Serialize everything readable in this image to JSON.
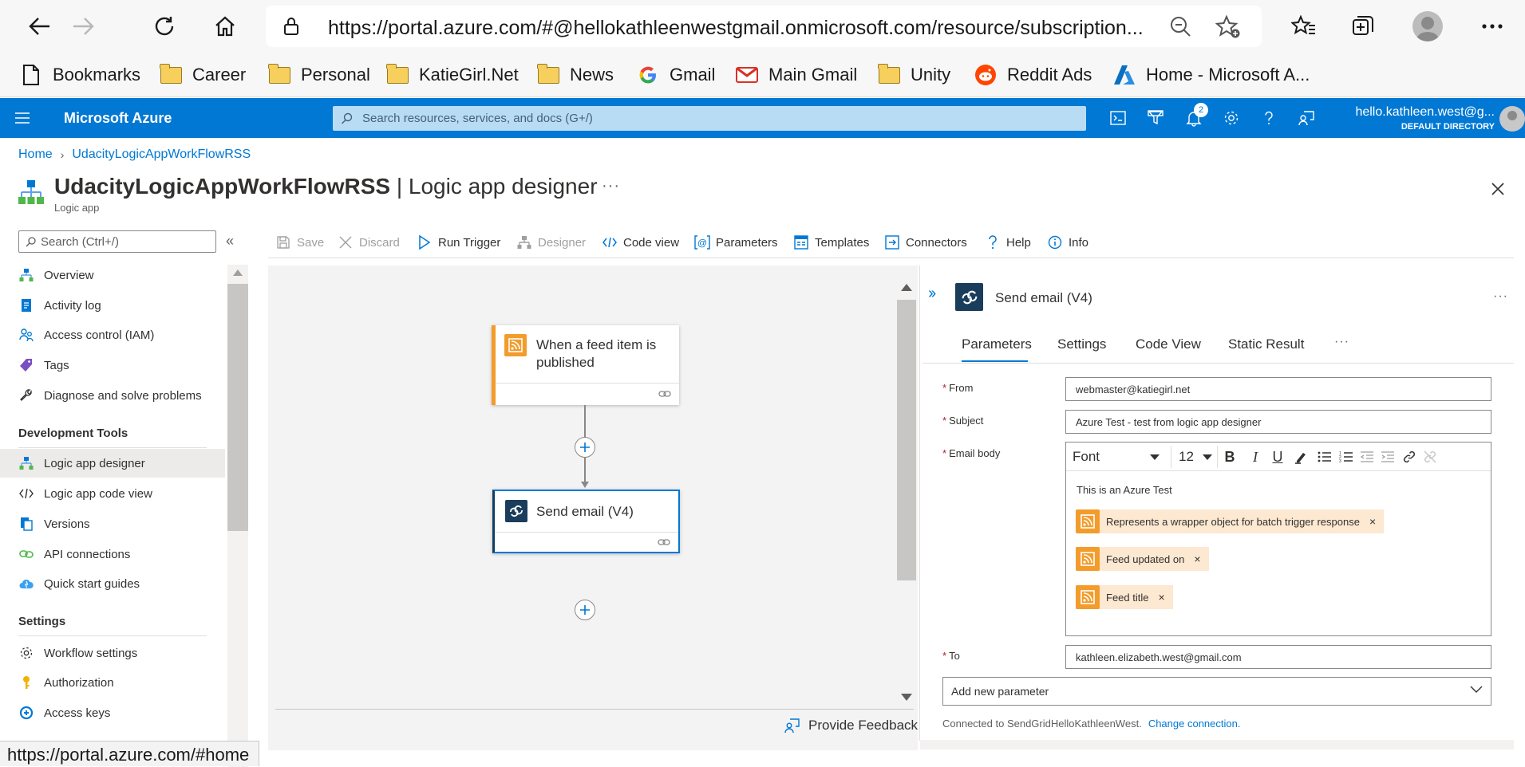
{
  "browser": {
    "url": "https://portal.azure.com/#@hellokathleenwestgmail.onmicrosoft.com/resource/subscription...",
    "bookmarks": [
      {
        "label": "Bookmarks",
        "icon": "page-icon"
      },
      {
        "label": "Career",
        "icon": "folder-icon"
      },
      {
        "label": "Personal",
        "icon": "folder-icon"
      },
      {
        "label": "KatieGirl.Net",
        "icon": "folder-icon"
      },
      {
        "label": "News",
        "icon": "folder-icon"
      },
      {
        "label": "Gmail",
        "icon": "google-icon"
      },
      {
        "label": "Main Gmail",
        "icon": "gmail-icon"
      },
      {
        "label": "Unity",
        "icon": "folder-icon"
      },
      {
        "label": "Reddit Ads",
        "icon": "reddit-icon"
      },
      {
        "label": "Home - Microsoft A...",
        "icon": "azure-icon"
      }
    ],
    "status_url": "https://portal.azure.com/#home"
  },
  "azure_header": {
    "brand": "Microsoft Azure",
    "search_placeholder": "Search resources, services, and docs (G+/)",
    "notification_count": "2",
    "account_name": "hello.kathleen.west@g...",
    "account_directory": "DEFAULT DIRECTORY"
  },
  "page": {
    "breadcrumb": [
      "Home",
      "UdacityLogicAppWorkFlowRSS"
    ],
    "resource_name": "UdacityLogicAppWorkFlowRSS",
    "blade_name": " | Logic app designer",
    "subtitle": "Logic app",
    "more": "···"
  },
  "menu": {
    "search_placeholder": "Search (Ctrl+/)",
    "collapse": "«",
    "items_top": [
      {
        "label": "Overview",
        "icon": "overview-icon"
      },
      {
        "label": "Activity log",
        "icon": "activity-log-icon"
      },
      {
        "label": "Access control (IAM)",
        "icon": "people-icon"
      },
      {
        "label": "Tags",
        "icon": "tag-icon"
      },
      {
        "label": "Diagnose and solve problems",
        "icon": "wrench-icon"
      }
    ],
    "section_dev": "Development Tools",
    "items_dev": [
      {
        "label": "Logic app designer",
        "icon": "designer-icon",
        "active": true
      },
      {
        "label": "Logic app code view",
        "icon": "code-icon"
      },
      {
        "label": "Versions",
        "icon": "versions-icon"
      },
      {
        "label": "API connections",
        "icon": "link-icon"
      },
      {
        "label": "Quick start guides",
        "icon": "cloud-icon"
      }
    ],
    "section_settings": "Settings",
    "items_settings": [
      {
        "label": "Workflow settings",
        "icon": "gear-icon"
      },
      {
        "label": "Authorization",
        "icon": "key-icon"
      },
      {
        "label": "Access keys",
        "icon": "access-keys-icon"
      }
    ]
  },
  "commands": [
    {
      "label": "Save",
      "icon": "save-icon",
      "disabled": true
    },
    {
      "label": "Discard",
      "icon": "discard-icon",
      "disabled": true
    },
    {
      "label": "Run Trigger",
      "icon": "play-icon"
    },
    {
      "label": "Designer",
      "icon": "designer-icon",
      "disabled": true
    },
    {
      "label": "Code view",
      "icon": "code-icon"
    },
    {
      "label": "Parameters",
      "icon": "parameters-icon"
    },
    {
      "label": "Templates",
      "icon": "templates-icon"
    },
    {
      "label": "Connectors",
      "icon": "connectors-icon"
    },
    {
      "label": "Help",
      "icon": "help-icon"
    },
    {
      "label": "Info",
      "icon": "info-icon"
    }
  ],
  "canvas": {
    "trigger_title": "When a feed item is published",
    "action_title": "Send email (V4)",
    "feedback": "Provide Feedback"
  },
  "panel": {
    "title": "Send email (V4)",
    "tabs": [
      "Parameters",
      "Settings",
      "Code View",
      "Static Result"
    ],
    "active_tab": "Parameters",
    "required_mark": "*",
    "from_label": "From",
    "from_value": "webmaster@katiegirl.net",
    "subject_label": "Subject",
    "subject_value": "Azure Test - test from logic app designer",
    "body_label": "Email body",
    "font": "Font",
    "font_size": "12",
    "body_text": "This is an Azure Test",
    "tokens": [
      "Represents a wrapper object for batch trigger response",
      "Feed updated on",
      "Feed title"
    ],
    "token_remove": "×",
    "to_label": "To",
    "to_value": "kathleen.elizabeth.west@gmail.com",
    "add_param_placeholder": "Add new parameter",
    "connection_text": "Connected to SendGridHelloKathleenWest.",
    "change_connection": "Change connection."
  },
  "colors": {
    "azure_blue": "#0078d4",
    "rss_orange": "#f39c2b",
    "token_bg": "#fde8d1",
    "required_red": "#a4262c"
  }
}
